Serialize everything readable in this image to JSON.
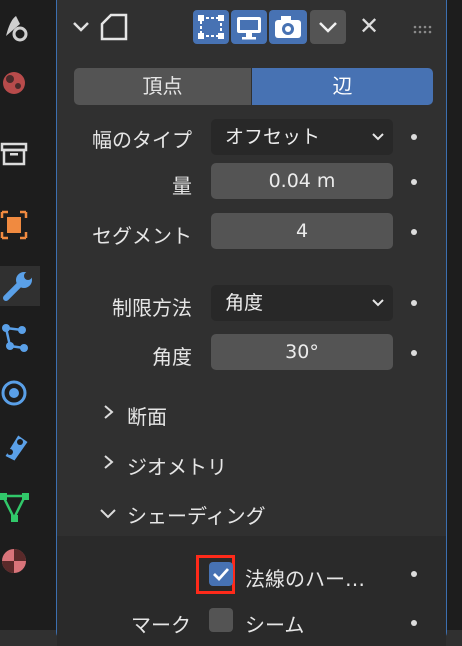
{
  "sidebar": {
    "icons": [
      "tool-icon",
      "scene-icon",
      "collection-icon",
      "object-icon",
      "modifier-icon",
      "particles-icon",
      "physics-icon",
      "constraints-icon",
      "object-data-icon",
      "material-icon"
    ],
    "colors": {
      "modifier": "#5aa0e8",
      "object": "#f08a40",
      "data": "#31c86a"
    }
  },
  "header": {
    "collapse_icon": "chevron-down-icon",
    "modifier_icon": "bevel-icon",
    "toggles": [
      "edit-mode-icon",
      "realtime-icon",
      "render-icon"
    ],
    "menu_icon": "chevron-down-icon",
    "close_label": "✕"
  },
  "affect": {
    "options": [
      "頂点",
      "辺"
    ],
    "selected": "辺"
  },
  "params": {
    "width_type_label": "幅のタイプ",
    "width_type_value": "オフセット",
    "amount_label": "量",
    "amount_value": "0.04 m",
    "segments_label": "セグメント",
    "segments_value": "4",
    "limit_method_label": "制限方法",
    "limit_method_value": "角度",
    "angle_label": "角度",
    "angle_value": "30°"
  },
  "subpanels": {
    "profile": "断面",
    "geometry": "ジオメトリ",
    "shading": "シェーディング"
  },
  "shading": {
    "harden_normals_label": "法線のハー…",
    "harden_normals_checked": true,
    "mark_label": "マーク",
    "seam_label": "シーム"
  },
  "accent": "#4772b3",
  "highlight": "#ff2a1a"
}
